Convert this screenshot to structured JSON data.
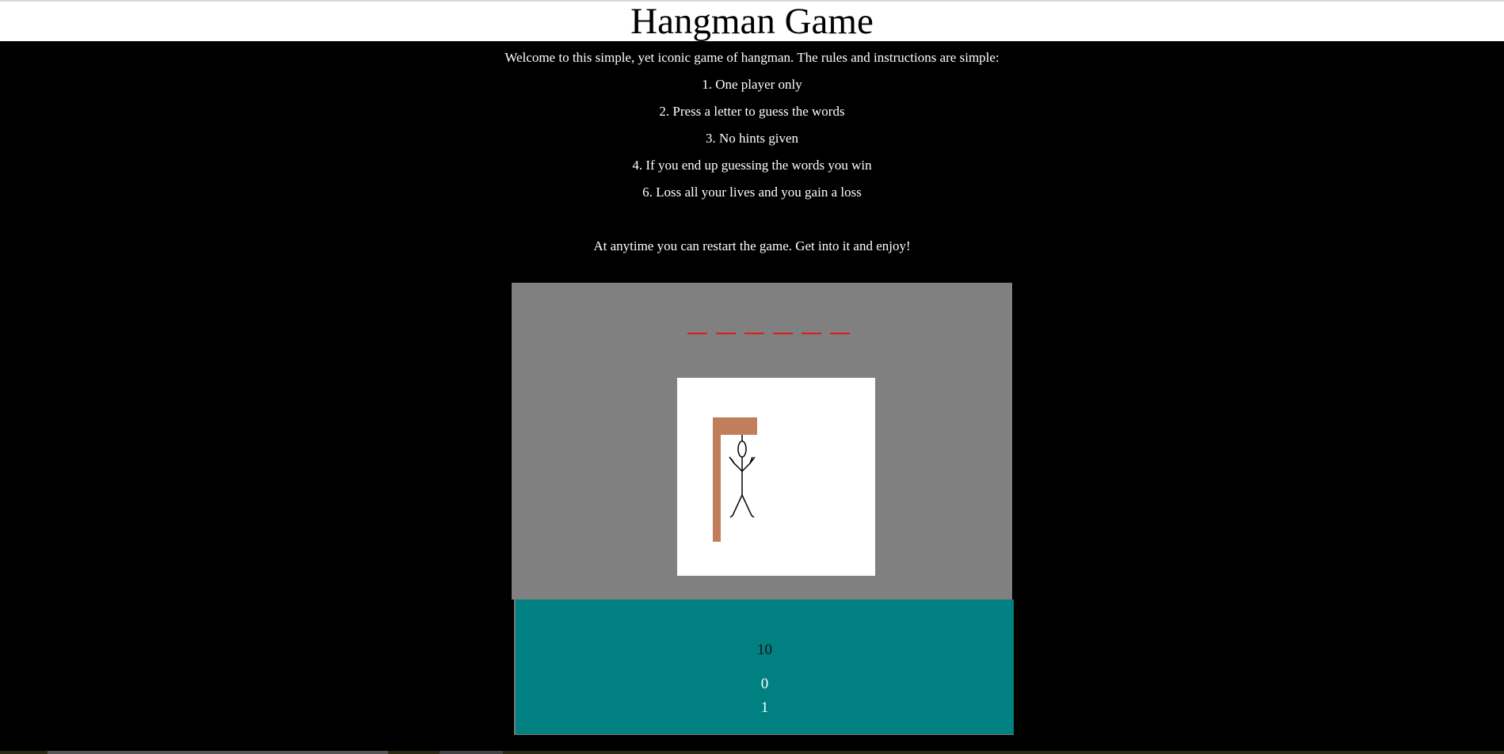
{
  "page": {
    "title": "Hangman Game"
  },
  "intro": {
    "welcome": "Welcome to this simple, yet iconic game of hangman. The rules and instructions are simple:",
    "rules": [
      "1. One player only",
      "2. Press a letter to guess the words",
      "3. No hints given",
      "4. If you end up guessing the words you win",
      "6. Loss all your lives and you gain a loss"
    ],
    "closing": "At anytime you can restart the game. Get into it and enjoy!"
  },
  "game": {
    "word_blanks": [
      "_",
      "_",
      "_",
      "_",
      "_",
      "_"
    ],
    "blank_color": "#e01b1b",
    "panel_color": "#808080",
    "gallows_color": "#c07e5a"
  },
  "stats": {
    "lives": "10",
    "wins": "0",
    "losses": "1",
    "panel_color": "#008080"
  }
}
